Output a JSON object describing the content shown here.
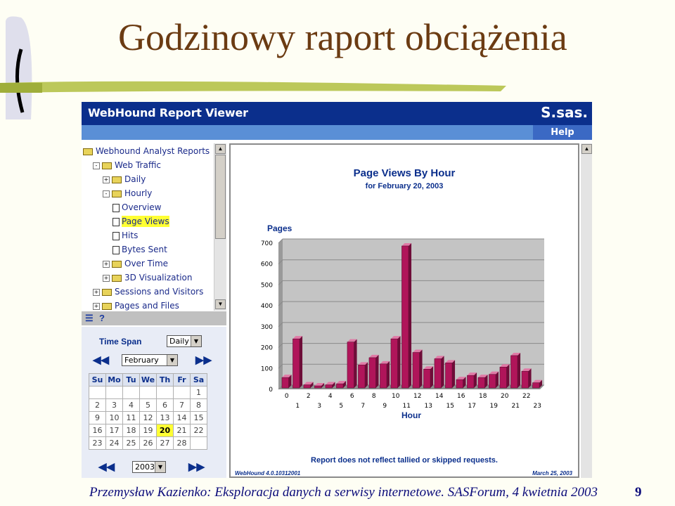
{
  "slide": {
    "title": "Godzinowy raport obciążenia",
    "footer": "Przemysław Kazienko: Eksploracja danych a serwisy internetowe.  SASForum, 4 kwietnia 2003",
    "page_number": "9"
  },
  "app": {
    "title": "WebHound Report Viewer",
    "logo": "S.sas.",
    "help": "Help"
  },
  "tree": [
    {
      "label": "Webhound Analyst Reports",
      "icon": "folder-open",
      "level": 0,
      "toggle": ""
    },
    {
      "label": "Web Traffic",
      "icon": "folder-open",
      "level": 1,
      "toggle": "−"
    },
    {
      "label": "Daily",
      "icon": "folder",
      "level": 2,
      "toggle": "+"
    },
    {
      "label": "Hourly",
      "icon": "folder-open",
      "level": 2,
      "toggle": "−"
    },
    {
      "label": "Overview",
      "icon": "document",
      "level": 3,
      "toggle": ""
    },
    {
      "label": "Page Views",
      "icon": "document",
      "level": 3,
      "toggle": "",
      "selected": true
    },
    {
      "label": "Hits",
      "icon": "document",
      "level": 3,
      "toggle": ""
    },
    {
      "label": "Bytes Sent",
      "icon": "document",
      "level": 3,
      "toggle": ""
    },
    {
      "label": "Over Time",
      "icon": "folder",
      "level": 2,
      "toggle": "+"
    },
    {
      "label": "3D Visualization",
      "icon": "folder",
      "level": 2,
      "toggle": "+"
    },
    {
      "label": "Sessions and Visitors",
      "icon": "folder",
      "level": 1,
      "toggle": "+"
    },
    {
      "label": "Pages and Files",
      "icon": "folder",
      "level": 1,
      "toggle": "+"
    }
  ],
  "toolbar": {
    "list_icon": "list-icon",
    "help_icon": "?"
  },
  "calendar": {
    "time_span_label": "Time Span",
    "time_span_value": "Daily",
    "month_value": "February",
    "year_value": "2003",
    "days": [
      "Su",
      "Mo",
      "Tu",
      "We",
      "Th",
      "Fr",
      "Sa"
    ],
    "weeks": [
      [
        "",
        "",
        "",
        "",
        "",
        "",
        "1"
      ],
      [
        "2",
        "3",
        "4",
        "5",
        "6",
        "7",
        "8"
      ],
      [
        "9",
        "10",
        "11",
        "12",
        "13",
        "14",
        "15"
      ],
      [
        "16",
        "17",
        "18",
        "19",
        "20",
        "21",
        "22"
      ],
      [
        "23",
        "24",
        "25",
        "26",
        "27",
        "28",
        ""
      ]
    ],
    "selected_day": "20"
  },
  "report": {
    "title": "Page Views By Hour",
    "subtitle": "for February 20, 2003",
    "note": "Report does not reflect tallied or skipped requests.",
    "version": "WebHound 4.0.10312001",
    "date": "March 25, 2003"
  },
  "chart_data": {
    "type": "bar",
    "ylabel": "Pages",
    "xlabel": "Hour",
    "ylim": [
      0,
      700
    ],
    "yticks": [
      0,
      100,
      200,
      300,
      400,
      500,
      600,
      700
    ],
    "categories": [
      "0",
      "1",
      "2",
      "3",
      "4",
      "5",
      "6",
      "7",
      "8",
      "9",
      "10",
      "11",
      "12",
      "13",
      "14",
      "15",
      "16",
      "17",
      "18",
      "19",
      "20",
      "21",
      "22",
      "23"
    ],
    "values": [
      50,
      235,
      15,
      10,
      15,
      20,
      220,
      110,
      145,
      115,
      235,
      680,
      170,
      90,
      140,
      120,
      40,
      60,
      50,
      65,
      100,
      155,
      80,
      25
    ],
    "bar_color": "#b0155a",
    "plot_bg": "#c4c4c4",
    "grid": true
  }
}
